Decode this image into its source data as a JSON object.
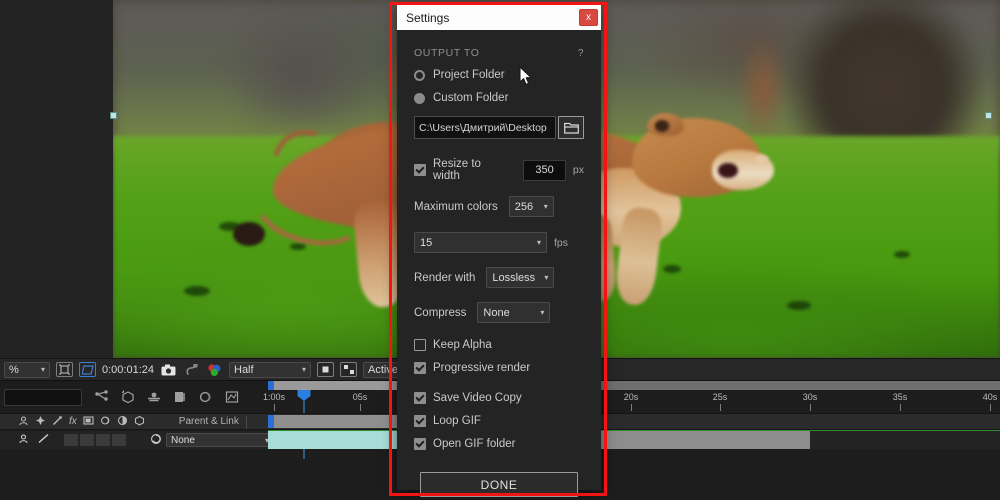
{
  "viewer_toolbar": {
    "zoom_level": "%",
    "timecode": "0:00:01:24",
    "resolution": "Half",
    "camera": "Active Camera",
    "icons": [
      "region-of-interest-icon",
      "transparency-grid-icon",
      "snapshot-icon",
      "show-snapshot-icon",
      "channels-icon",
      "mask-path-icon",
      "alpha-boundaries-icon"
    ]
  },
  "timeline": {
    "search_placeholder": "",
    "ruler_labels": [
      "1:00s",
      "05s",
      "20s",
      "25s",
      "30s",
      "35s",
      "40s"
    ],
    "column_header": "Parent & Link",
    "parent_value": "None",
    "toolbar_icons": [
      "graph-editor-icon",
      "motion-blur-icon",
      "frame-blend-icon",
      "shy-icon",
      "draft-3d-icon",
      "brainstorm-icon"
    ],
    "layer_switch_icons": [
      "shy-icon",
      "collapse-transformations-icon",
      "quality-icon",
      "effects-icon",
      "frame-blend-icon",
      "motion-blur-icon",
      "adjustment-layer-icon",
      "3d-layer-icon"
    ]
  },
  "dialog": {
    "title": "Settings",
    "close_label": "x",
    "section_output": {
      "heading": "OUTPUT TO",
      "help": "?",
      "options": [
        {
          "label": "Project Folder",
          "selected": false
        },
        {
          "label": "Custom Folder",
          "selected": true
        }
      ],
      "path_value": "C:\\Users\\Дмитрий\\Desktop",
      "browse_icon": "folder-icon"
    },
    "resize": {
      "label": "Resize to width",
      "checked": true,
      "value": "350",
      "unit": "px"
    },
    "max_colors": {
      "label": "Maximum colors",
      "value": "256"
    },
    "fps": {
      "value": "15",
      "unit": "fps"
    },
    "render_with": {
      "label": "Render with",
      "value": "Lossless"
    },
    "compress": {
      "label": "Compress",
      "value": "None"
    },
    "toggles": [
      {
        "label": "Keep Alpha",
        "checked": false
      },
      {
        "label": "Progressive render",
        "checked": true
      },
      {
        "label": "Save Video Copy",
        "checked": true
      },
      {
        "label": "Loop GIF",
        "checked": true
      },
      {
        "label": "Open GIF folder",
        "checked": true
      }
    ],
    "done_label": "DONE"
  },
  "colors": {
    "accent_red": "#f51414",
    "close_red": "#d9493f",
    "playhead_blue": "#2a7fe0",
    "work_area_green": "#2f8f2f",
    "clip_teal": "#a8dcd6"
  }
}
